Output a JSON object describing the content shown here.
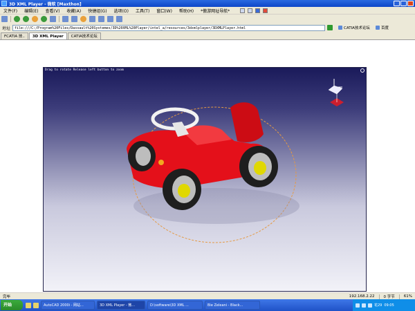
{
  "window": {
    "title": "3D XML Player - 微软 [Maxthon]"
  },
  "menu": [
    "文件(F)",
    "编辑(E)",
    "查看(V)",
    "收藏(A)",
    "快捷组(G)",
    "选项(O)",
    "工具(T)",
    "窗口(W)",
    "帮助(H)",
    "*傲游网址导航*"
  ],
  "address": {
    "label": "地址",
    "url": "file:///C:/Program%20Files/Dassault%20Systemes/3D%20XML%20Player/intel_a/resources/3dxmlplayer/3DXMLPlayer.html",
    "links": [
      "CATIA技术论坛",
      "百度"
    ]
  },
  "tabs": [
    {
      "label": "FCATIA 技.."
    },
    {
      "label": "3D XML Player"
    },
    {
      "label": "CATIA技术论坛"
    }
  ],
  "player": {
    "help_text": "Drag to rotate   Release left button to zoom"
  },
  "statusbar": {
    "left": "完毕",
    "ip": "192.168.2.22",
    "bytes": "0 字节",
    "zoom": "61%"
  },
  "taskbar": {
    "start": "开始",
    "tasks": [
      "AutoCAD 2000i - 网站...",
      "3D XML Player - 微...",
      "D:\\software\\3D XML ...",
      "Bie Zeleani - Black..."
    ],
    "time": "09:05",
    "tray_text": "花29"
  }
}
